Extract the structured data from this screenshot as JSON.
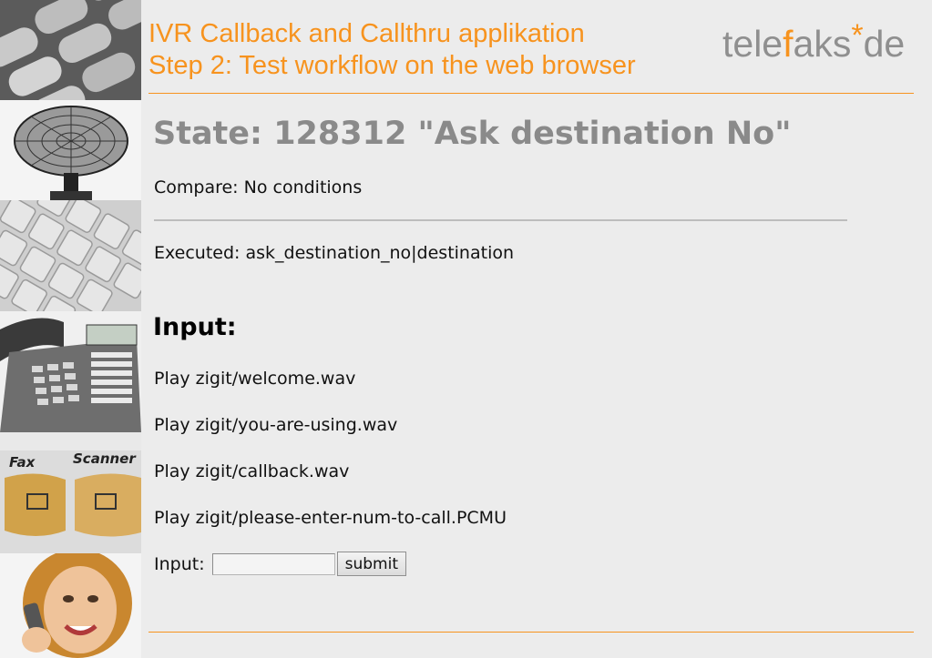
{
  "header": {
    "line1": "IVR Callback and Callthru applikation",
    "line2": "Step 2: Test workflow on the web browser"
  },
  "logo": {
    "part1": "tele",
    "part2": "f",
    "part3": "aks",
    "star": "*",
    "part4": "de"
  },
  "state": {
    "title": "State: 128312 \"Ask destination No\"",
    "compare": "Compare: No conditions",
    "executed": "Executed: ask_destination_no|destination"
  },
  "input_section": {
    "heading": "Input:",
    "plays": [
      "Play zigit/welcome.wav",
      "Play zigit/you-are-using.wav",
      "Play zigit/callback.wav",
      "Play zigit/please-enter-num-to-call.PCMU"
    ],
    "field_label": "Input:",
    "field_value": "",
    "submit_label": "submit"
  },
  "sidebar_images": {
    "fax_label": "Fax",
    "scanner_label": "Scanner"
  },
  "colors": {
    "accent": "#f7931e",
    "logo_grey": "#8f8f8f",
    "state_grey": "#8a8a8a",
    "background": "#ececec"
  }
}
